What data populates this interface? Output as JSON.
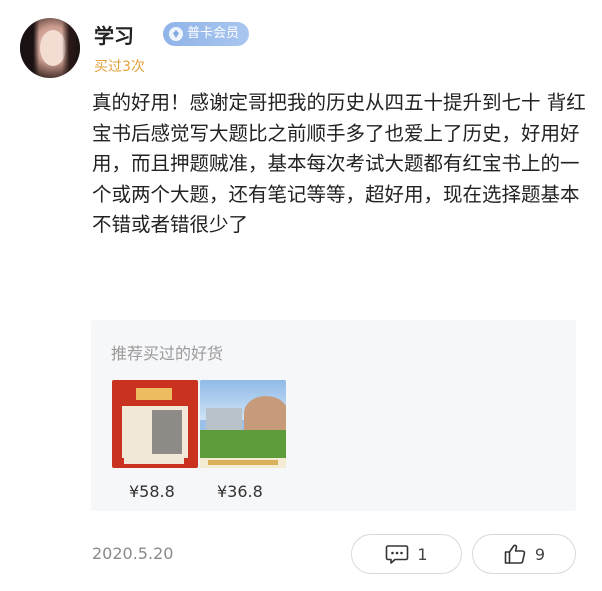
{
  "user": {
    "name": "学习",
    "badge": "普卡会员",
    "buy_count": "买过3次"
  },
  "review": {
    "text": "真的好用！感谢定哥把我的历史从四五十提升到七十 背红宝书后感觉写大题比之前顺手多了也爱上了历史，好用好用，而且押题贼准，基本每次考试大题都有红宝书上的一个或两个大题，还有笔记等等，超好用，现在选择题基本不错或者错很少了"
  },
  "recommend": {
    "title": "推荐买过的好货",
    "products": [
      {
        "price": "¥58.8"
      },
      {
        "price": "¥36.8"
      }
    ]
  },
  "footer": {
    "date": "2020.5.20",
    "comment_count": "1",
    "like_count": "9"
  },
  "icons": {
    "badge": "shield-icon",
    "comment": "comment-icon",
    "like": "thumbs-up-icon"
  },
  "colors": {
    "badge_bg": "#8fb4e8",
    "buy_count": "#e2a23c",
    "panel_bg": "#f6f7f9"
  }
}
